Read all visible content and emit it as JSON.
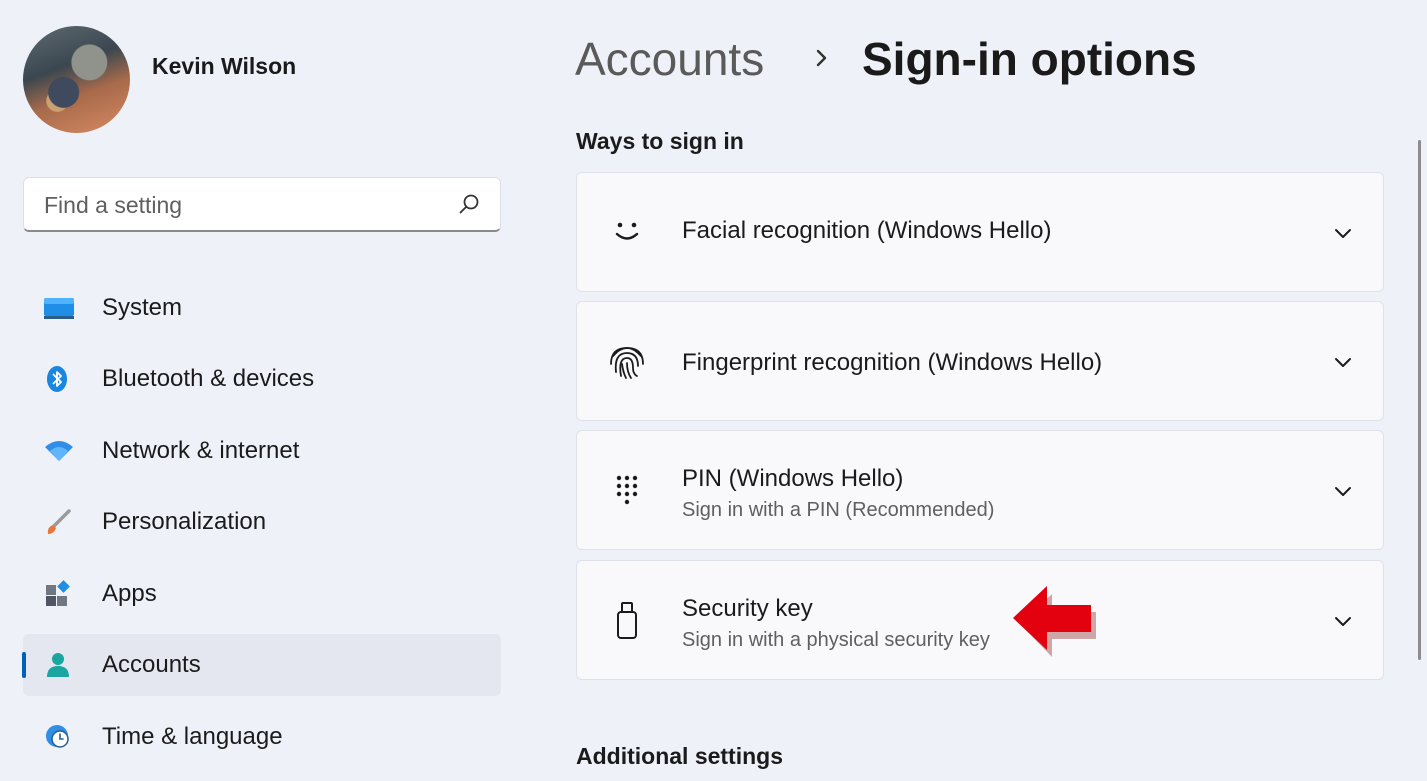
{
  "user": {
    "name": "Kevin Wilson"
  },
  "search": {
    "placeholder": "Find a setting"
  },
  "sidebar": {
    "items": [
      {
        "label": "System",
        "icon": "monitor-icon"
      },
      {
        "label": "Bluetooth & devices",
        "icon": "bluetooth-icon"
      },
      {
        "label": "Network & internet",
        "icon": "wifi-icon"
      },
      {
        "label": "Personalization",
        "icon": "paintbrush-icon"
      },
      {
        "label": "Apps",
        "icon": "apps-icon"
      },
      {
        "label": "Accounts",
        "icon": "person-icon",
        "active": true
      },
      {
        "label": "Time & language",
        "icon": "clock-globe-icon"
      }
    ]
  },
  "breadcrumb": {
    "parent": "Accounts",
    "current": "Sign-in options"
  },
  "sections": {
    "ways": "Ways to sign in",
    "additional": "Additional settings"
  },
  "options": [
    {
      "title": "Facial recognition (Windows Hello)",
      "subtitle": "",
      "icon": "smiley-face-icon"
    },
    {
      "title": "Fingerprint recognition (Windows Hello)",
      "subtitle": "",
      "icon": "fingerprint-icon"
    },
    {
      "title": "PIN (Windows Hello)",
      "subtitle": "Sign in with a PIN (Recommended)",
      "icon": "pin-keypad-icon"
    },
    {
      "title": "Security key",
      "subtitle": "Sign in with a physical security key",
      "icon": "usb-key-icon"
    }
  ],
  "colors": {
    "accent": "#005fb8",
    "annotation_arrow": "#e3000f",
    "background": "#eef1f8"
  }
}
